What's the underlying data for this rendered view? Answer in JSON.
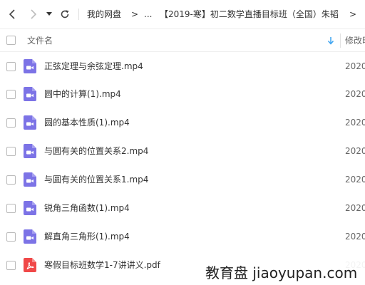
{
  "toolbar": {
    "breadcrumbs": [
      "我的网盘",
      ">",
      "...",
      "【2019-寒】初二数学直播目标班（全国）朱韬",
      ">"
    ]
  },
  "header": {
    "name_label": "文件名",
    "modified_label": "修改时"
  },
  "files": [
    {
      "name": "正弦定理与余弦定理.mp4",
      "date": "2020",
      "icon": "video-file-icon"
    },
    {
      "name": "圆中的计算(1).mp4",
      "date": "2020",
      "icon": "video-file-icon"
    },
    {
      "name": "圆的基本性质(1).mp4",
      "date": "2020",
      "icon": "video-file-icon"
    },
    {
      "name": "与圆有关的位置关系2.mp4",
      "date": "2020",
      "icon": "video-file-icon"
    },
    {
      "name": "与圆有关的位置关系1.mp4",
      "date": "2020",
      "icon": "video-file-icon"
    },
    {
      "name": "锐角三角函数(1).mp4",
      "date": "2020",
      "icon": "video-file-icon"
    },
    {
      "name": "解直角三角形(1).mp4",
      "date": "2020",
      "icon": "video-file-icon"
    },
    {
      "name": "寒假目标班数学1-7讲讲义.pdf",
      "date": "2020",
      "icon": "pdf-file-icon"
    }
  ],
  "watermark": "教育盘 jiaoyupan.com",
  "colors": {
    "video_icon": "#7c73e6",
    "pdf_icon": "#f04848",
    "sort_arrow": "#3ba3f0"
  }
}
